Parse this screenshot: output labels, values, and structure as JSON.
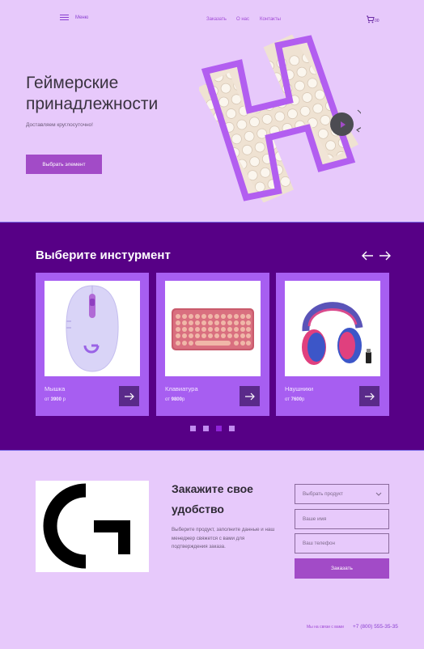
{
  "header": {
    "menu_label": "Меню",
    "nav": [
      {
        "label": "Заказать"
      },
      {
        "label": "О нас"
      },
      {
        "label": "Контакты"
      }
    ],
    "cart_count": "00"
  },
  "hero": {
    "title_line1": "Геймерские",
    "title_line2": "принадлежности",
    "subtitle": "Доставляем круглосуточно!",
    "button_label": "Выбрать элемент"
  },
  "products": {
    "title": "Выберите инстурмент",
    "cards": [
      {
        "name": "Мышка",
        "price_prefix": "от",
        "price": "3900",
        "price_suffix": "р"
      },
      {
        "name": "Клавиатура",
        "price_prefix": "от",
        "price": "9800",
        "price_suffix": "р"
      },
      {
        "name": "Наушники",
        "price_prefix": "от",
        "price": "7600",
        "price_suffix": "р"
      }
    ],
    "active_slide": 3
  },
  "order": {
    "title_line1": "Закажите свое",
    "title_line2": "удобство",
    "text": "Выберите продукт, заполните данные и наш менеджер свяжется с вами для подтверждения заказа.",
    "select_label": "Выбрать продукт",
    "name_placeholder": "Ваше имя",
    "phone_placeholder": "Ваш телефон",
    "button_label": "Заказать",
    "contact_label": "Мы на связи с вами",
    "phone": "+7 (800) 555-35-35"
  },
  "colors": {
    "accent": "#a24bc7",
    "dark_purple": "#570086",
    "card": "#a75ef1",
    "background": "#e7c9fb"
  }
}
